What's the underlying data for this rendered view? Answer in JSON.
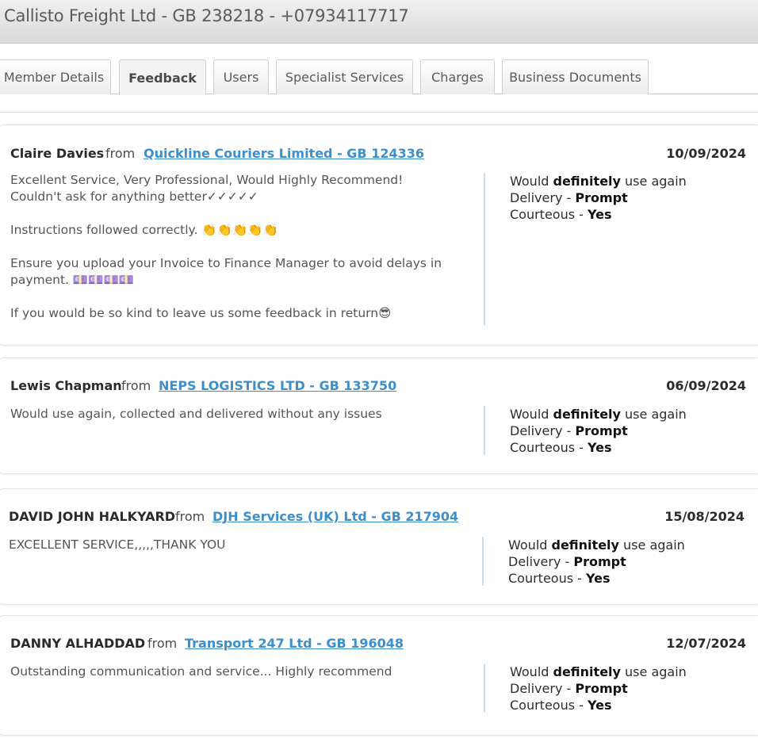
{
  "header": {
    "title": "Callisto Freight Ltd - GB 238218 - +07934117717"
  },
  "tabs": [
    {
      "label": "Member Details",
      "active": false
    },
    {
      "label": "Feedback",
      "active": true
    },
    {
      "label": "Users",
      "active": false
    },
    {
      "label": "Specialist Services",
      "active": false
    },
    {
      "label": "Charges",
      "active": false
    },
    {
      "label": "Business Documents",
      "active": false
    }
  ],
  "ratings_text": {
    "would_pre": "Would ",
    "would_bold": "definitely",
    "would_post": " use again",
    "delivery_pre": "Delivery - ",
    "courteous_pre": "Courteous - "
  },
  "feedback": [
    {
      "reviewer": "Claire Davies",
      "from": "from",
      "company": "Quickline Couriers Limited - GB 124336",
      "date": "10/09/2024",
      "comment": [
        "Excellent Service, Very Professional, Would Highly Recommend!\nCouldn't ask for anything better✓✓✓✓✓",
        "Instructions followed correctly. 👏👏👏👏👏",
        "Ensure you upload your Invoice to Finance Manager to avoid delays in\npayment. 💷💷💷💷",
        "If you would be so kind to leave us some feedback in return😎"
      ],
      "delivery": "Prompt",
      "courteous": "Yes"
    },
    {
      "reviewer": "Lewis Chapman",
      "from": "from",
      "company": "NEPS LOGISTICS LTD - GB 133750",
      "date": "06/09/2024",
      "comment": [
        "Would use again, collected and delivered without any issues"
      ],
      "delivery": "Prompt",
      "courteous": "Yes"
    },
    {
      "reviewer": "DAVID JOHN HALKYARD",
      "from": "from",
      "company": "DJH Services (UK) Ltd - GB 217904",
      "date": "15/08/2024",
      "comment": [
        "EXCELLENT SERVICE,,,,,THANK YOU"
      ],
      "delivery": "Prompt",
      "courteous": "Yes"
    },
    {
      "reviewer": "DANNY ALHADDAD",
      "from": "from",
      "company": "Transport 247 Ltd - GB 196048",
      "date": "12/07/2024",
      "comment": [
        "Outstanding communication and service... Highly recommend"
      ],
      "delivery": "Prompt",
      "courteous": "Yes"
    }
  ]
}
